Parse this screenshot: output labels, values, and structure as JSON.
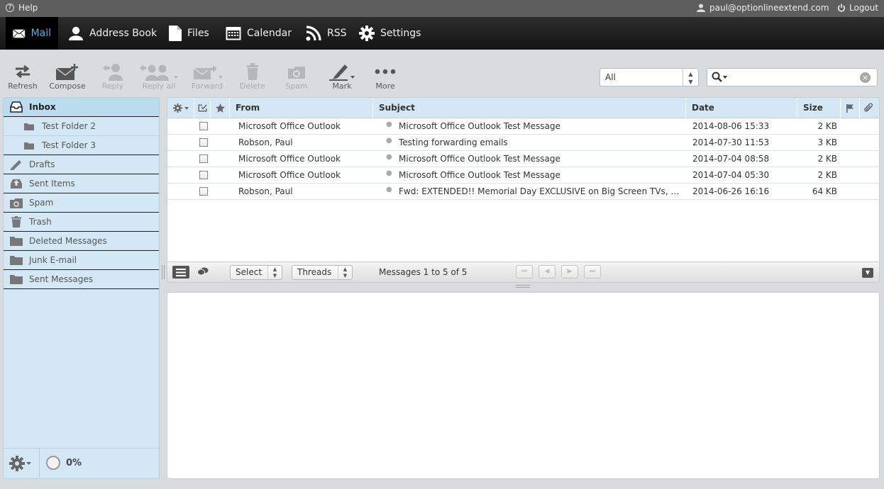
{
  "topbar": {
    "help_label": "Help",
    "user_email": "paul@optionlineextend.com",
    "logout_label": "Logout"
  },
  "nav": {
    "mail": "Mail",
    "addressbook": "Address Book",
    "files": "Files",
    "calendar": "Calendar",
    "rss": "RSS",
    "settings": "Settings"
  },
  "toolbar": {
    "refresh": "Refresh",
    "compose": "Compose",
    "reply": "Reply",
    "reply_all": "Reply all",
    "forward": "Forward",
    "delete": "Delete",
    "spam": "Spam",
    "mark": "Mark",
    "more": "More",
    "filter_value": "All",
    "search_value": ""
  },
  "folders": [
    {
      "name": "Inbox"
    },
    {
      "name": "Test Folder 2"
    },
    {
      "name": "Test Folder 3"
    },
    {
      "name": "Drafts"
    },
    {
      "name": "Sent Items"
    },
    {
      "name": "Spam"
    },
    {
      "name": "Trash"
    },
    {
      "name": "Deleted Messages"
    },
    {
      "name": "Junk E-mail"
    },
    {
      "name": "Sent Messages"
    }
  ],
  "quota": "0%",
  "list": {
    "headers": {
      "from": "From",
      "subject": "Subject",
      "date": "Date",
      "size": "Size"
    },
    "messages": [
      {
        "from": "Microsoft Office Outlook",
        "subject": "Microsoft Office Outlook Test Message",
        "date": "2014-08-06 15:33",
        "size": "2 KB"
      },
      {
        "from": "Robson, Paul",
        "subject": "Testing forwarding emails",
        "date": "2014-07-30 11:53",
        "size": "3 KB"
      },
      {
        "from": "Microsoft Office Outlook",
        "subject": "Microsoft Office Outlook Test Message",
        "date": "2014-07-04 08:58",
        "size": "2 KB"
      },
      {
        "from": "Microsoft Office Outlook",
        "subject": "Microsoft Office Outlook Test Message",
        "date": "2014-07-04 05:30",
        "size": "2 KB"
      },
      {
        "from": "Robson, Paul",
        "subject": "Fwd: EXTENDED!! Memorial Day EXCLUSIVE on Big Screen TVs, HU...",
        "date": "2014-06-26 16:16",
        "size": "64 KB"
      }
    ],
    "footer": {
      "select_label": "Select",
      "threads_label": "Threads",
      "count_text": "Messages 1 to 5 of 5"
    }
  },
  "colors": {
    "accent": "#4fb0e6",
    "sidebar_bg": "#d3e8f4",
    "navbar_bg": "#1e1e1e"
  }
}
